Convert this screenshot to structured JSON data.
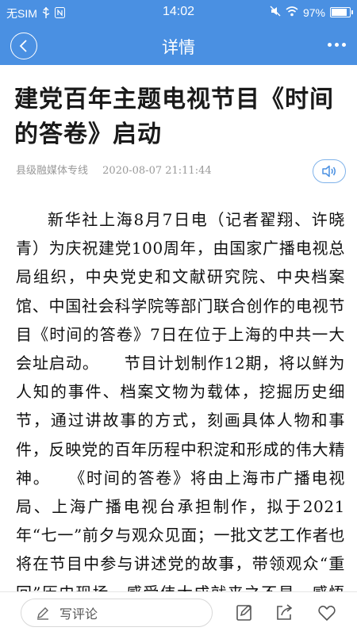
{
  "status_bar": {
    "carrier": "无SIM",
    "time": "14:02",
    "battery": "97%",
    "battery_level": 0.97
  },
  "nav": {
    "title": "详情",
    "back_icon": "chevron-left-icon",
    "more_icon": "more-dots-icon"
  },
  "article": {
    "title": "建党百年主题电视节目《时间的答卷》启动",
    "source": "县级融媒体专线",
    "datetime": "2020-08-07  21:11:44",
    "body": "新华社上海8月7日电（记者翟翔、许晓青）为庆祝建党100周年，由国家广播电视总局组织，中央党史和文献研究院、中央档案馆、中国社会科学院等部门联合创作的电视节目《时间的答卷》7日在位于上海的中共一大会址启动。　　节目计划制作12期，将以鲜为人知的事件、档案文物为载体，挖掘历史细节，通过讲故事的方式，刻画具体人物和事件，反映党的百年历程中积淀和形成的伟大精神。　　《时间的答卷》将由上海市广播电视局、上海广播电视台承担制作，拟于2021年“七一”前夕与观众见面；一批文艺工作者也将在节目中参与讲述党的故事，带领观众“重回”历史现场，感受伟大成就来之不易，感悟中国共产党为"
  },
  "bottom_bar": {
    "comment_placeholder": "写评论",
    "icons": [
      "pencil-icon",
      "edit-icon",
      "share-icon",
      "heart-icon"
    ]
  },
  "colors": {
    "accent": "#4a90e2",
    "meta_text": "#999999"
  }
}
